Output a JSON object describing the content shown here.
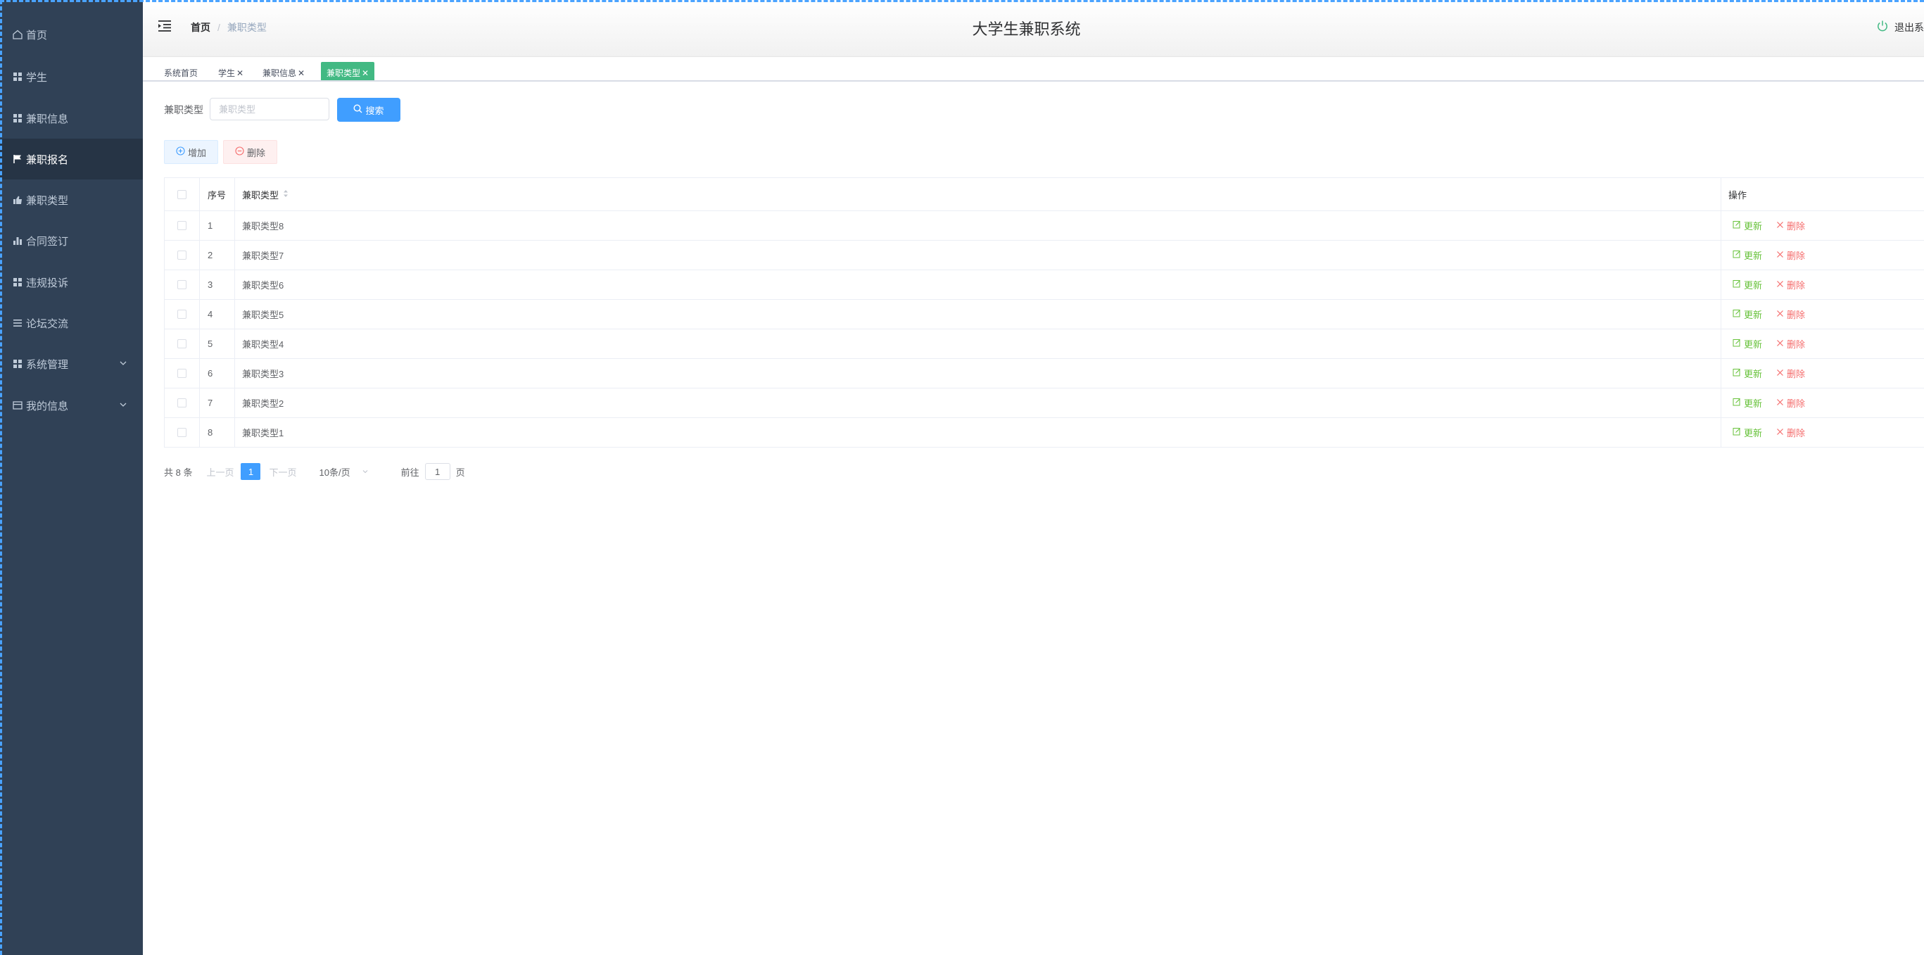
{
  "header": {
    "app_title": "大学生兼职系统",
    "logout_label": "退出系",
    "breadcrumb": {
      "home": "首页",
      "current": "兼职类型"
    }
  },
  "sidebar": {
    "items": [
      {
        "label": "首页",
        "icon": "home-icon"
      },
      {
        "label": "学生",
        "icon": "grid-icon"
      },
      {
        "label": "兼职信息",
        "icon": "grid-icon"
      },
      {
        "label": "兼职报名",
        "icon": "flag-icon",
        "active": true
      },
      {
        "label": "兼职类型",
        "icon": "thumb-up-icon"
      },
      {
        "label": "合同签订",
        "icon": "bar-chart-icon"
      },
      {
        "label": "违规投诉",
        "icon": "grid-icon"
      },
      {
        "label": "论坛交流",
        "icon": "list-icon"
      },
      {
        "label": "系统管理",
        "icon": "grid-icon",
        "expandable": true
      },
      {
        "label": "我的信息",
        "icon": "card-icon",
        "expandable": true
      }
    ]
  },
  "tags": [
    {
      "label": "系统首页",
      "closable": false
    },
    {
      "label": "学生",
      "closable": true
    },
    {
      "label": "兼职信息",
      "closable": true
    },
    {
      "label": "兼职类型",
      "closable": true,
      "active": true
    }
  ],
  "search": {
    "label": "兼职类型",
    "placeholder": "兼职类型",
    "button_label": "搜索"
  },
  "actions": {
    "add_label": "增加",
    "delete_label": "删除"
  },
  "table": {
    "headers": {
      "index": "序号",
      "type": "兼职类型",
      "ops": "操作"
    },
    "update_label": "更新",
    "delete_label": "删除",
    "rows": [
      {
        "index": "1",
        "type": "兼职类型8"
      },
      {
        "index": "2",
        "type": "兼职类型7"
      },
      {
        "index": "3",
        "type": "兼职类型6"
      },
      {
        "index": "4",
        "type": "兼职类型5"
      },
      {
        "index": "5",
        "type": "兼职类型4"
      },
      {
        "index": "6",
        "type": "兼职类型3"
      },
      {
        "index": "7",
        "type": "兼职类型2"
      },
      {
        "index": "8",
        "type": "兼职类型1"
      }
    ]
  },
  "pagination": {
    "total": "共 8 条",
    "prev": "上一页",
    "current_page": "1",
    "next": "下一页",
    "page_size": "10条/页",
    "jump_prefix": "前往",
    "jump_value": "1",
    "jump_suffix": "页"
  },
  "colors": {
    "sidebar_bg": "#304156",
    "sidebar_active_bg": "#263445",
    "primary": "#409eff",
    "success": "#67c23a",
    "danger": "#f56c6c",
    "tag_active": "#42b983"
  }
}
